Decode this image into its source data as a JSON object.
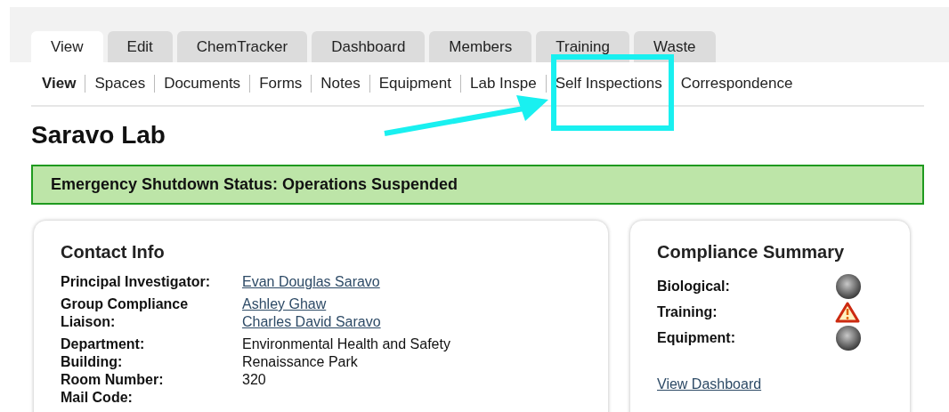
{
  "tabs": [
    {
      "label": "View",
      "selected": true
    },
    {
      "label": "Edit",
      "selected": false
    },
    {
      "label": "ChemTracker",
      "selected": false
    },
    {
      "label": "Dashboard",
      "selected": false
    },
    {
      "label": "Members",
      "selected": false
    },
    {
      "label": "Training",
      "selected": false
    },
    {
      "label": "Waste",
      "selected": false
    }
  ],
  "subnav": [
    {
      "label": "View",
      "selected": true
    },
    {
      "label": "Spaces",
      "selected": false
    },
    {
      "label": "Documents",
      "selected": false
    },
    {
      "label": "Forms",
      "selected": false
    },
    {
      "label": "Notes",
      "selected": false
    },
    {
      "label": "Equipment",
      "selected": false
    },
    {
      "label": "Lab Inspe",
      "selected": false
    },
    {
      "label": "Self Inspections",
      "selected": false
    },
    {
      "label": "Correspondence",
      "selected": false
    }
  ],
  "title": "Saravo Lab",
  "banner": "Emergency Shutdown Status: Operations Suspended",
  "contact_info": {
    "heading": "Contact Info",
    "rows": [
      {
        "label": "Principal Investigator:",
        "kind": "links",
        "values": [
          "Evan Douglas Saravo"
        ]
      },
      {
        "label": "Group Compliance Liaison:",
        "kind": "links",
        "values": [
          "Ashley Ghaw",
          "Charles David Saravo"
        ]
      },
      {
        "label": "Department:",
        "kind": "text",
        "values": [
          "Environmental Health and Safety"
        ]
      },
      {
        "label": "Building:",
        "kind": "text",
        "values": [
          "Renaissance Park"
        ]
      },
      {
        "label": "Room Number:",
        "kind": "text",
        "values": [
          "320"
        ]
      },
      {
        "label": "Mail Code:",
        "kind": "text",
        "values": []
      }
    ]
  },
  "compliance_summary": {
    "heading": "Compliance Summary",
    "items": [
      {
        "label": "Biological:",
        "kind": "neutral"
      },
      {
        "label": "Training:",
        "kind": "warning"
      },
      {
        "label": "Equipment:",
        "kind": "neutral"
      }
    ],
    "link": "View Dashboard"
  }
}
